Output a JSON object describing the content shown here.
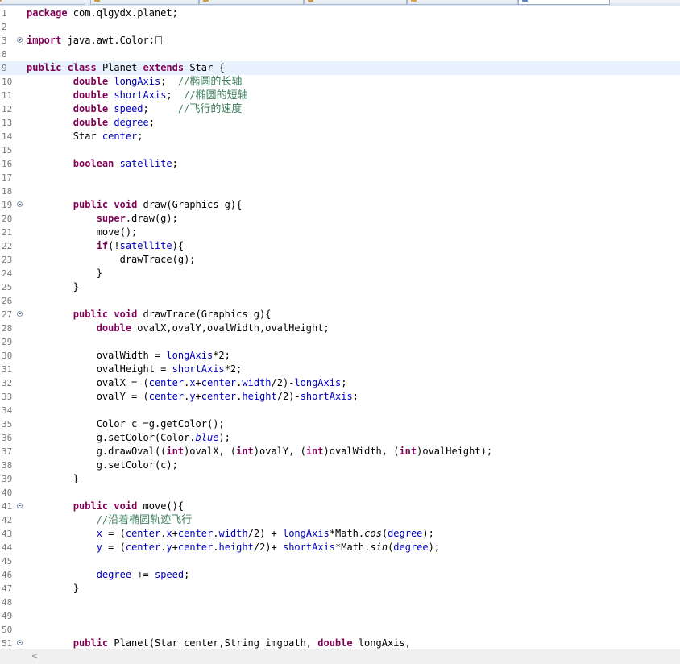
{
  "editor": {
    "current_line": "9",
    "fold_box_label": "…",
    "lines": [
      {
        "n": "1",
        "tokens": [
          {
            "t": "package",
            "c": "kw"
          },
          {
            "t": " com.qlgydx.planet;"
          }
        ]
      },
      {
        "n": "2",
        "tokens": []
      },
      {
        "n": "3",
        "fold": "plus",
        "tokens": [
          {
            "t": "import",
            "c": "kw"
          },
          {
            "t": " java.awt.Color;"
          },
          {
            "t": "",
            "c": "foldbox"
          }
        ]
      },
      {
        "n": "8",
        "tokens": []
      },
      {
        "n": "9",
        "tokens": [
          {
            "t": "public",
            "c": "kw"
          },
          {
            "t": " "
          },
          {
            "t": "class",
            "c": "kw"
          },
          {
            "t": " Planet "
          },
          {
            "t": "extends",
            "c": "kw"
          },
          {
            "t": " Star {"
          }
        ]
      },
      {
        "n": "10",
        "tokens": [
          {
            "t": "        "
          },
          {
            "t": "double",
            "c": "kw"
          },
          {
            "t": " "
          },
          {
            "t": "longAxis",
            "c": "fld"
          },
          {
            "t": ";  "
          },
          {
            "t": "//",
            "c": "cmt"
          },
          {
            "t": "椭圆的长轴",
            "c": "cmt cjk"
          }
        ]
      },
      {
        "n": "11",
        "tokens": [
          {
            "t": "        "
          },
          {
            "t": "double",
            "c": "kw"
          },
          {
            "t": " "
          },
          {
            "t": "shortAxis",
            "c": "fld"
          },
          {
            "t": ";  "
          },
          {
            "t": "//",
            "c": "cmt"
          },
          {
            "t": "椭圆的短轴",
            "c": "cmt cjk"
          }
        ]
      },
      {
        "n": "12",
        "tokens": [
          {
            "t": "        "
          },
          {
            "t": "double",
            "c": "kw"
          },
          {
            "t": " "
          },
          {
            "t": "speed",
            "c": "fld"
          },
          {
            "t": ";     "
          },
          {
            "t": "//",
            "c": "cmt"
          },
          {
            "t": "飞行的速度",
            "c": "cmt cjk"
          }
        ]
      },
      {
        "n": "13",
        "tokens": [
          {
            "t": "        "
          },
          {
            "t": "double",
            "c": "kw"
          },
          {
            "t": " "
          },
          {
            "t": "degree",
            "c": "fld"
          },
          {
            "t": ";"
          }
        ]
      },
      {
        "n": "14",
        "tokens": [
          {
            "t": "        Star "
          },
          {
            "t": "center",
            "c": "fld"
          },
          {
            "t": ";"
          }
        ]
      },
      {
        "n": "15",
        "tokens": []
      },
      {
        "n": "16",
        "tokens": [
          {
            "t": "        "
          },
          {
            "t": "boolean",
            "c": "kw"
          },
          {
            "t": " "
          },
          {
            "t": "satellite",
            "c": "fld"
          },
          {
            "t": ";"
          }
        ]
      },
      {
        "n": "17",
        "tokens": []
      },
      {
        "n": "18",
        "tokens": []
      },
      {
        "n": "19",
        "fold": "minus",
        "tokens": [
          {
            "t": "        "
          },
          {
            "t": "public",
            "c": "kw"
          },
          {
            "t": " "
          },
          {
            "t": "void",
            "c": "kw"
          },
          {
            "t": " draw(Graphics g){"
          }
        ]
      },
      {
        "n": "20",
        "tokens": [
          {
            "t": "            "
          },
          {
            "t": "super",
            "c": "kw"
          },
          {
            "t": ".draw(g);"
          }
        ]
      },
      {
        "n": "21",
        "tokens": [
          {
            "t": "            move();"
          }
        ]
      },
      {
        "n": "22",
        "tokens": [
          {
            "t": "            "
          },
          {
            "t": "if",
            "c": "kw"
          },
          {
            "t": "(!"
          },
          {
            "t": "satellite",
            "c": "fld"
          },
          {
            "t": "){"
          }
        ]
      },
      {
        "n": "23",
        "tokens": [
          {
            "t": "                drawTrace(g);"
          }
        ]
      },
      {
        "n": "24",
        "tokens": [
          {
            "t": "            }"
          }
        ]
      },
      {
        "n": "25",
        "tokens": [
          {
            "t": "        }"
          }
        ]
      },
      {
        "n": "26",
        "tokens": []
      },
      {
        "n": "27",
        "fold": "minus",
        "tokens": [
          {
            "t": "        "
          },
          {
            "t": "public",
            "c": "kw"
          },
          {
            "t": " "
          },
          {
            "t": "void",
            "c": "kw"
          },
          {
            "t": " drawTrace(Graphics g){"
          }
        ]
      },
      {
        "n": "28",
        "tokens": [
          {
            "t": "            "
          },
          {
            "t": "double",
            "c": "kw"
          },
          {
            "t": " ovalX,ovalY,ovalWidth,ovalHeight;"
          }
        ]
      },
      {
        "n": "29",
        "tokens": []
      },
      {
        "n": "30",
        "tokens": [
          {
            "t": "            ovalWidth = "
          },
          {
            "t": "longAxis",
            "c": "fld"
          },
          {
            "t": "*2;"
          }
        ]
      },
      {
        "n": "31",
        "tokens": [
          {
            "t": "            ovalHeight = "
          },
          {
            "t": "shortAxis",
            "c": "fld"
          },
          {
            "t": "*2;"
          }
        ]
      },
      {
        "n": "32",
        "tokens": [
          {
            "t": "            ovalX = ("
          },
          {
            "t": "center",
            "c": "fld"
          },
          {
            "t": "."
          },
          {
            "t": "x",
            "c": "fld"
          },
          {
            "t": "+"
          },
          {
            "t": "center",
            "c": "fld"
          },
          {
            "t": "."
          },
          {
            "t": "width",
            "c": "fld"
          },
          {
            "t": "/2)-"
          },
          {
            "t": "longAxis",
            "c": "fld"
          },
          {
            "t": ";"
          }
        ]
      },
      {
        "n": "33",
        "tokens": [
          {
            "t": "            ovalY = ("
          },
          {
            "t": "center",
            "c": "fld"
          },
          {
            "t": "."
          },
          {
            "t": "y",
            "c": "fld"
          },
          {
            "t": "+"
          },
          {
            "t": "center",
            "c": "fld"
          },
          {
            "t": "."
          },
          {
            "t": "height",
            "c": "fld"
          },
          {
            "t": "/2)-"
          },
          {
            "t": "shortAxis",
            "c": "fld"
          },
          {
            "t": ";"
          }
        ]
      },
      {
        "n": "34",
        "tokens": []
      },
      {
        "n": "35",
        "tokens": [
          {
            "t": "            Color c =g.getColor();"
          }
        ]
      },
      {
        "n": "36",
        "tokens": [
          {
            "t": "            g.setColor(Color."
          },
          {
            "t": "blue",
            "c": "fld it"
          },
          {
            "t": ");"
          }
        ]
      },
      {
        "n": "37",
        "tokens": [
          {
            "t": "            g.drawOval(("
          },
          {
            "t": "int",
            "c": "kw"
          },
          {
            "t": ")ovalX, ("
          },
          {
            "t": "int",
            "c": "kw"
          },
          {
            "t": ")ovalY, ("
          },
          {
            "t": "int",
            "c": "kw"
          },
          {
            "t": ")ovalWidth, ("
          },
          {
            "t": "int",
            "c": "kw"
          },
          {
            "t": ")ovalHeight);"
          }
        ]
      },
      {
        "n": "38",
        "tokens": [
          {
            "t": "            g.setColor(c);"
          }
        ]
      },
      {
        "n": "39",
        "tokens": [
          {
            "t": "        }"
          }
        ]
      },
      {
        "n": "40",
        "tokens": []
      },
      {
        "n": "41",
        "fold": "minus",
        "tokens": [
          {
            "t": "        "
          },
          {
            "t": "public",
            "c": "kw"
          },
          {
            "t": " "
          },
          {
            "t": "void",
            "c": "kw"
          },
          {
            "t": " move(){"
          }
        ]
      },
      {
        "n": "42",
        "tokens": [
          {
            "t": "            "
          },
          {
            "t": "//",
            "c": "cmt"
          },
          {
            "t": "沿着椭圆轨迹飞行",
            "c": "cmt cjk"
          }
        ]
      },
      {
        "n": "43",
        "tokens": [
          {
            "t": "            "
          },
          {
            "t": "x",
            "c": "fld"
          },
          {
            "t": " = ("
          },
          {
            "t": "center",
            "c": "fld"
          },
          {
            "t": "."
          },
          {
            "t": "x",
            "c": "fld"
          },
          {
            "t": "+"
          },
          {
            "t": "center",
            "c": "fld"
          },
          {
            "t": "."
          },
          {
            "t": "width",
            "c": "fld"
          },
          {
            "t": "/2) + "
          },
          {
            "t": "longAxis",
            "c": "fld"
          },
          {
            "t": "*Math."
          },
          {
            "t": "cos",
            "c": "it"
          },
          {
            "t": "("
          },
          {
            "t": "degree",
            "c": "fld"
          },
          {
            "t": ");"
          }
        ]
      },
      {
        "n": "44",
        "tokens": [
          {
            "t": "            "
          },
          {
            "t": "y",
            "c": "fld"
          },
          {
            "t": " = ("
          },
          {
            "t": "center",
            "c": "fld"
          },
          {
            "t": "."
          },
          {
            "t": "y",
            "c": "fld"
          },
          {
            "t": "+"
          },
          {
            "t": "center",
            "c": "fld"
          },
          {
            "t": "."
          },
          {
            "t": "height",
            "c": "fld"
          },
          {
            "t": "/2)+ "
          },
          {
            "t": "shortAxis",
            "c": "fld"
          },
          {
            "t": "*Math."
          },
          {
            "t": "sin",
            "c": "it"
          },
          {
            "t": "("
          },
          {
            "t": "degree",
            "c": "fld"
          },
          {
            "t": ");"
          }
        ]
      },
      {
        "n": "45",
        "tokens": []
      },
      {
        "n": "46",
        "tokens": [
          {
            "t": "            "
          },
          {
            "t": "degree",
            "c": "fld"
          },
          {
            "t": " += "
          },
          {
            "t": "speed",
            "c": "fld"
          },
          {
            "t": ";"
          }
        ]
      },
      {
        "n": "47",
        "tokens": [
          {
            "t": "        }"
          }
        ]
      },
      {
        "n": "48",
        "tokens": []
      },
      {
        "n": "49",
        "tokens": []
      },
      {
        "n": "50",
        "tokens": []
      },
      {
        "n": "51",
        "fold": "minus",
        "tokens": [
          {
            "t": "        "
          },
          {
            "t": "public",
            "c": "kw"
          },
          {
            "t": " Planet(Star center,String imgpath, "
          },
          {
            "t": "double",
            "c": "kw"
          },
          {
            "t": " longAxis,"
          }
        ]
      }
    ]
  },
  "scrollbar": {
    "left_arrow": "<"
  }
}
